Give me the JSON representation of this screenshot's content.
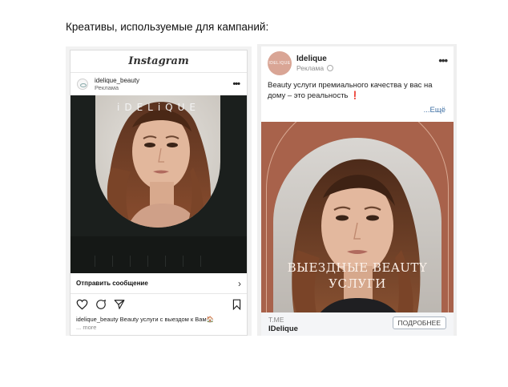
{
  "page": {
    "heading": "Креативы, используемые для кампаний:"
  },
  "instagram": {
    "app_title": "Instagram",
    "username": "idelique_beauty",
    "sponsored": "Реклама",
    "brand_text": "iDELiQUE",
    "cta": "Отправить сообщение",
    "caption_user": "idelique_beauty",
    "caption_text": "Beauty услуги с выездом к Вам🏠",
    "caption_more": "... more"
  },
  "vk": {
    "page_name": "Idelique",
    "sponsored": "Реклама",
    "avatar_text": "IDELIQUE",
    "post_text": "Beauty услуги премиального качества у вас на дому – это реальность",
    "post_emoji": "❗",
    "read_more": "...Ещё",
    "overlay_line1": "ВЫЕЗДНЫЕ BEAUTY",
    "overlay_line2": "УСЛУГИ",
    "link_domain": "T.ME",
    "link_name": "IDelique",
    "button_label": "ПОДРОБНЕЕ"
  },
  "colors": {
    "vk_bg": "#a8624b",
    "ig_bg": "#1b1f1d",
    "vk_link": "#3c6ea3"
  }
}
